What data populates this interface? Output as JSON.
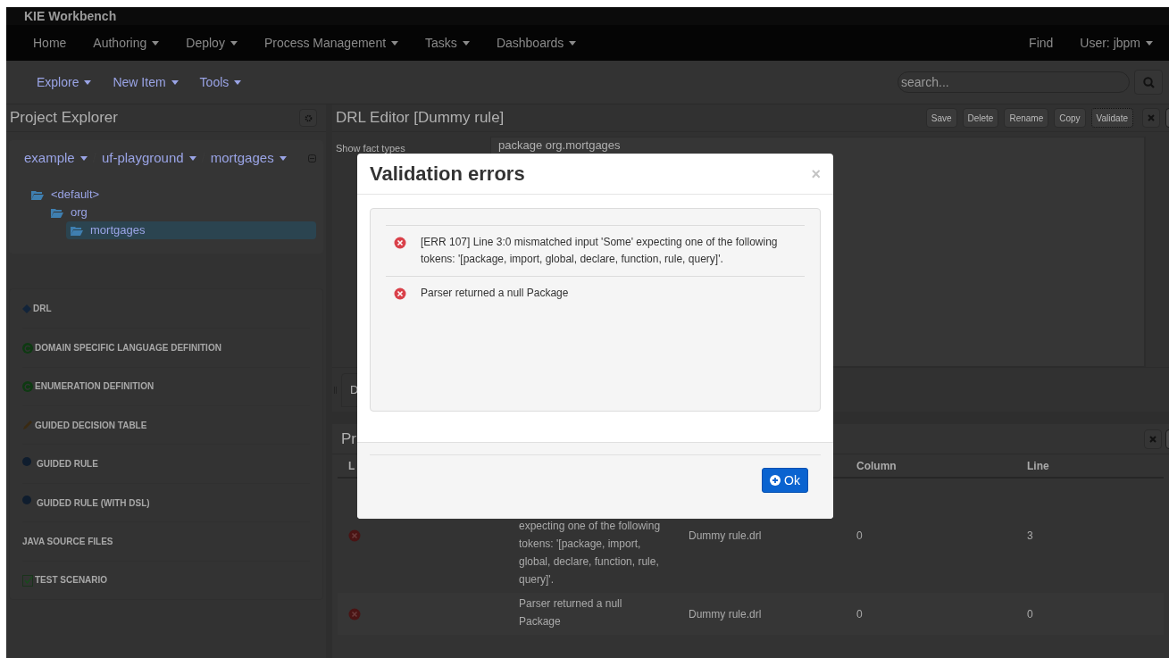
{
  "app": {
    "title": "KIE Workbench"
  },
  "nav": {
    "items": [
      {
        "label": "Home",
        "dropdown": false
      },
      {
        "label": "Authoring",
        "dropdown": true
      },
      {
        "label": "Deploy",
        "dropdown": true
      },
      {
        "label": "Process Management",
        "dropdown": true
      },
      {
        "label": "Tasks",
        "dropdown": true
      },
      {
        "label": "Dashboards",
        "dropdown": true
      }
    ],
    "right": [
      {
        "label": "Find",
        "dropdown": false
      },
      {
        "label": "User: jbpm",
        "dropdown": true
      }
    ]
  },
  "toolbar": {
    "menus": [
      {
        "label": "Explore"
      },
      {
        "label": "New Item"
      },
      {
        "label": "Tools"
      }
    ],
    "search": {
      "placeholder": "search..."
    }
  },
  "explorer": {
    "title": "Project Explorer",
    "breadcrumb": [
      "example",
      "uf-playground",
      "mortgages"
    ],
    "tree": [
      {
        "label": "<default>",
        "selected": false,
        "children": [
          {
            "label": "org",
            "selected": false,
            "children": [
              {
                "label": "mortgages",
                "selected": true
              }
            ]
          }
        ]
      }
    ],
    "types": [
      {
        "label": "DRL",
        "kind": "diamond"
      },
      {
        "label": "DOMAIN SPECIFIC LANGUAGE DEFINITION",
        "kind": "circle"
      },
      {
        "label": "ENUMERATION DEFINITION",
        "kind": "circle"
      },
      {
        "label": "GUIDED DECISION TABLE",
        "kind": "pencil"
      },
      {
        "label": "GUIDED RULE",
        "kind": "dot"
      },
      {
        "label": "GUIDED RULE (WITH DSL)",
        "kind": "dot"
      },
      {
        "label": "JAVA SOURCE FILES",
        "kind": "none"
      },
      {
        "label": "TEST SCENARIO",
        "kind": "checklist"
      }
    ]
  },
  "editor": {
    "title": "DRL Editor [Dummy rule]",
    "buttons": [
      {
        "label": "Save",
        "focused": false
      },
      {
        "label": "Delete",
        "focused": false
      },
      {
        "label": "Rename",
        "focused": false
      },
      {
        "label": "Copy",
        "focused": false
      },
      {
        "label": "Validate",
        "focused": true
      }
    ],
    "fact_types_label": "Show fact types",
    "code": "package org.mortgages",
    "tab": "D"
  },
  "problems": {
    "title": "Pr",
    "columns": [
      "L",
      "Column",
      "Line"
    ],
    "rows": [
      {
        "kind": "error",
        "message": "expecting one of the following tokens: '[package, import, global, declare, function, rule, query]'.",
        "file": "Dummy rule.drl",
        "column": "0",
        "line": "3"
      },
      {
        "kind": "error",
        "message": "Parser returned a null Package",
        "file": "Dummy rule.drl",
        "column": "0",
        "line": "0"
      }
    ]
  },
  "dialog": {
    "title": "Validation errors",
    "close": "×",
    "errors": [
      {
        "kind": "error",
        "text": "[ERR 107] Line 3:0 mismatched input 'Some' expecting one of the following tokens: '[package, import, global, declare, function, rule, query]'."
      },
      {
        "kind": "error",
        "text": "Parser returned a null Package"
      }
    ],
    "ok": "Ok"
  }
}
